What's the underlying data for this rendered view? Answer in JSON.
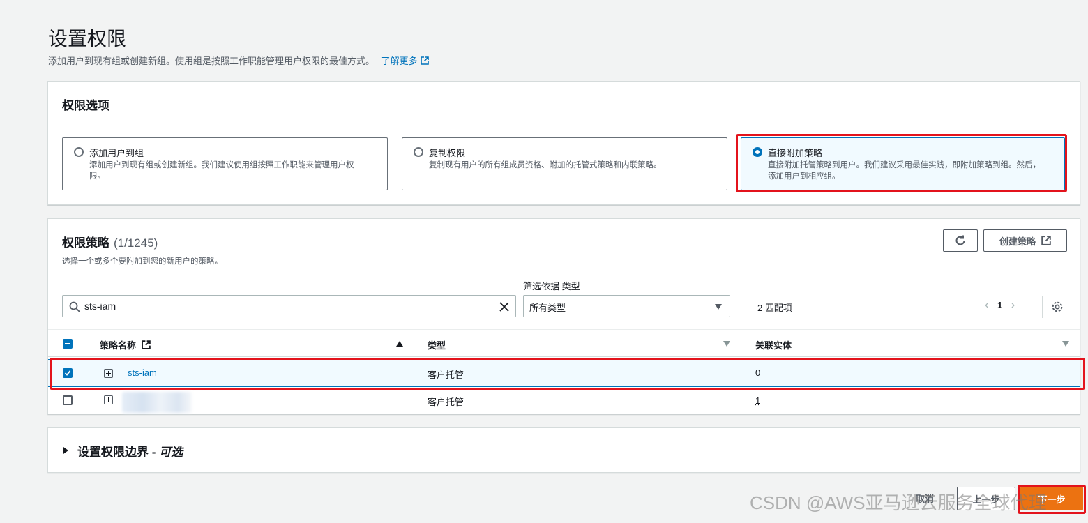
{
  "page": {
    "title": "设置权限",
    "description": "添加用户到现有组或创建新组。使用组是按照工作职能管理用户权限的最佳方式。",
    "learn_more": "了解更多"
  },
  "options": {
    "heading": "权限选项",
    "tiles": [
      {
        "title": "添加用户到组",
        "desc_line1": "添加用户到现有组或创建新组。我们建议使用组按照工作职能来管理用户权",
        "desc_line2": "限。",
        "selected": false
      },
      {
        "title": "复制权限",
        "desc_line1": "复制现有用户的所有组成员资格、附加的托管式策略和内联策略。",
        "desc_line2": "",
        "selected": false
      },
      {
        "title": "直接附加策略",
        "desc_line1": "直接附加托管策略到用户。我们建议采用最佳实践，即附加策略到组。然后，",
        "desc_line2": "添加用户到相应组。",
        "selected": true
      }
    ]
  },
  "policies": {
    "heading": "权限策略",
    "count": "(1/1245)",
    "description": "选择一个或多个要附加到您的新用户的策略。",
    "create_button": "创建策略",
    "filter_label": "筛选依据 类型",
    "search_value": "sts-iam",
    "type_select": "所有类型",
    "matches": "2 匹配项",
    "page_number": "1",
    "columns": {
      "name": "策略名称",
      "type": "类型",
      "entities": "关联实体"
    },
    "rows": [
      {
        "name": "sts-iam",
        "type": "客户托管",
        "entities": "0",
        "checked": true
      },
      {
        "name": "",
        "type": "客户托管",
        "entities": "1",
        "checked": false
      }
    ]
  },
  "boundary": {
    "title": "设置权限边界 - ",
    "optional": "可选"
  },
  "footer": {
    "cancel": "取消",
    "previous": "上一步",
    "next": "下一步"
  },
  "watermark": "CSDN @AWS亚马逊云服务全球代理",
  "colors": {
    "accent": "#0073bb",
    "primary_button": "#ec7211",
    "highlight_box": "#e3131c"
  }
}
